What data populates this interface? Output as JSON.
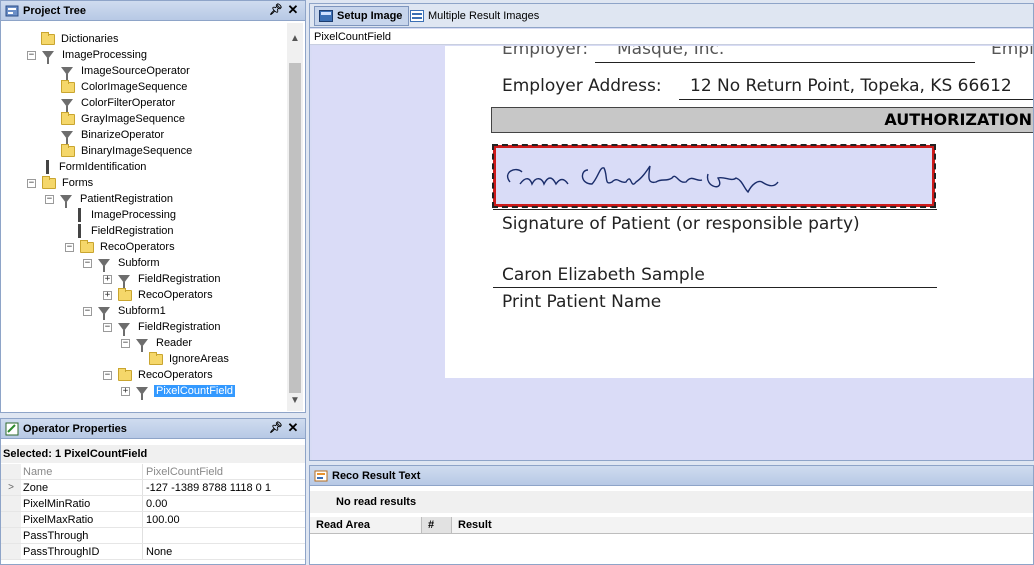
{
  "project_tree": {
    "title": "Project Tree",
    "pin_icon": "pin-icon",
    "close_icon": "close-icon",
    "items": [
      {
        "label": "Dictionaries",
        "icon": "folder-icon",
        "toggle": ""
      },
      {
        "label": "ImageProcessing",
        "icon": "funnel-icon",
        "toggle": "−"
      },
      {
        "label": "ImageSourceOperator",
        "icon": "funnel-icon",
        "toggle": ""
      },
      {
        "label": "ColorImageSequence",
        "icon": "folder-icon",
        "toggle": ""
      },
      {
        "label": "ColorFilterOperator",
        "icon": "funnel-icon",
        "toggle": ""
      },
      {
        "label": "GrayImageSequence",
        "icon": "folder-icon",
        "toggle": ""
      },
      {
        "label": "BinarizeOperator",
        "icon": "funnel-icon",
        "toggle": ""
      },
      {
        "label": "BinaryImageSequence",
        "icon": "folder-icon",
        "toggle": ""
      },
      {
        "label": "FormIdentification",
        "icon": "bar-icon",
        "toggle": ""
      },
      {
        "label": "Forms",
        "icon": "folder-icon",
        "toggle": "−"
      },
      {
        "label": "PatientRegistration",
        "icon": "funnel-icon",
        "toggle": "−"
      },
      {
        "label": "ImageProcessing",
        "icon": "bar-icon",
        "toggle": ""
      },
      {
        "label": "FieldRegistration",
        "icon": "bar-icon",
        "toggle": ""
      },
      {
        "label": "RecoOperators",
        "icon": "folder-icon",
        "toggle": "−"
      },
      {
        "label": "Subform",
        "icon": "funnel-icon",
        "toggle": "−"
      },
      {
        "label": "FieldRegistration",
        "icon": "funnel-icon",
        "toggle": "+"
      },
      {
        "label": "RecoOperators",
        "icon": "folder-icon",
        "toggle": "+"
      },
      {
        "label": "Subform1",
        "icon": "funnel-icon",
        "toggle": "−"
      },
      {
        "label": "FieldRegistration",
        "icon": "funnel-icon",
        "toggle": "−"
      },
      {
        "label": "Reader",
        "icon": "funnel-icon",
        "toggle": "−"
      },
      {
        "label": "IgnoreAreas",
        "icon": "folder-icon",
        "toggle": ""
      },
      {
        "label": "RecoOperators",
        "icon": "folder-icon",
        "toggle": "−"
      },
      {
        "label": "PixelCountField",
        "icon": "funnel-icon",
        "toggle": "+",
        "selected": true
      }
    ]
  },
  "operator_properties": {
    "title": "Operator Properties",
    "selected_label": "Selected: 1 PixelCountField",
    "rows": [
      {
        "name": "Name",
        "value": "PixelCountField",
        "disabled": true
      },
      {
        "name": "Zone",
        "value": "-127 -1389 8788 1118 0 1",
        "marker": ">"
      },
      {
        "name": "PixelMinRatio",
        "value": "0.00"
      },
      {
        "name": "PixelMaxRatio",
        "value": "100.00"
      },
      {
        "name": "PassThrough",
        "value": ""
      },
      {
        "name": "PassThroughID",
        "value": "None"
      }
    ]
  },
  "doc_tabs": [
    {
      "label": "Setup Image",
      "active": true
    },
    {
      "label": "Multiple Result Images",
      "active": false
    }
  ],
  "field_label": "PixelCountField",
  "document": {
    "employer_partial": "Employer:",
    "employer_value_partial": "Masque, Inc.",
    "employer_right_partial": "Emplo",
    "address_label": "Employer Address:",
    "address_value": "12 No Return Point, Topeka, KS 66612",
    "section_header": "AUTHORIZATION",
    "signature_text": "Caron Elizabeth Sample",
    "signature_caption": "Signature of Patient (or responsible party)",
    "printed_name": "Caron Elizabeth Sample",
    "printed_caption": "Print Patient Name"
  },
  "reco_result": {
    "title": "Reco Result Text",
    "status": "No read results",
    "columns": [
      "Read Area",
      "#",
      "Result"
    ]
  }
}
